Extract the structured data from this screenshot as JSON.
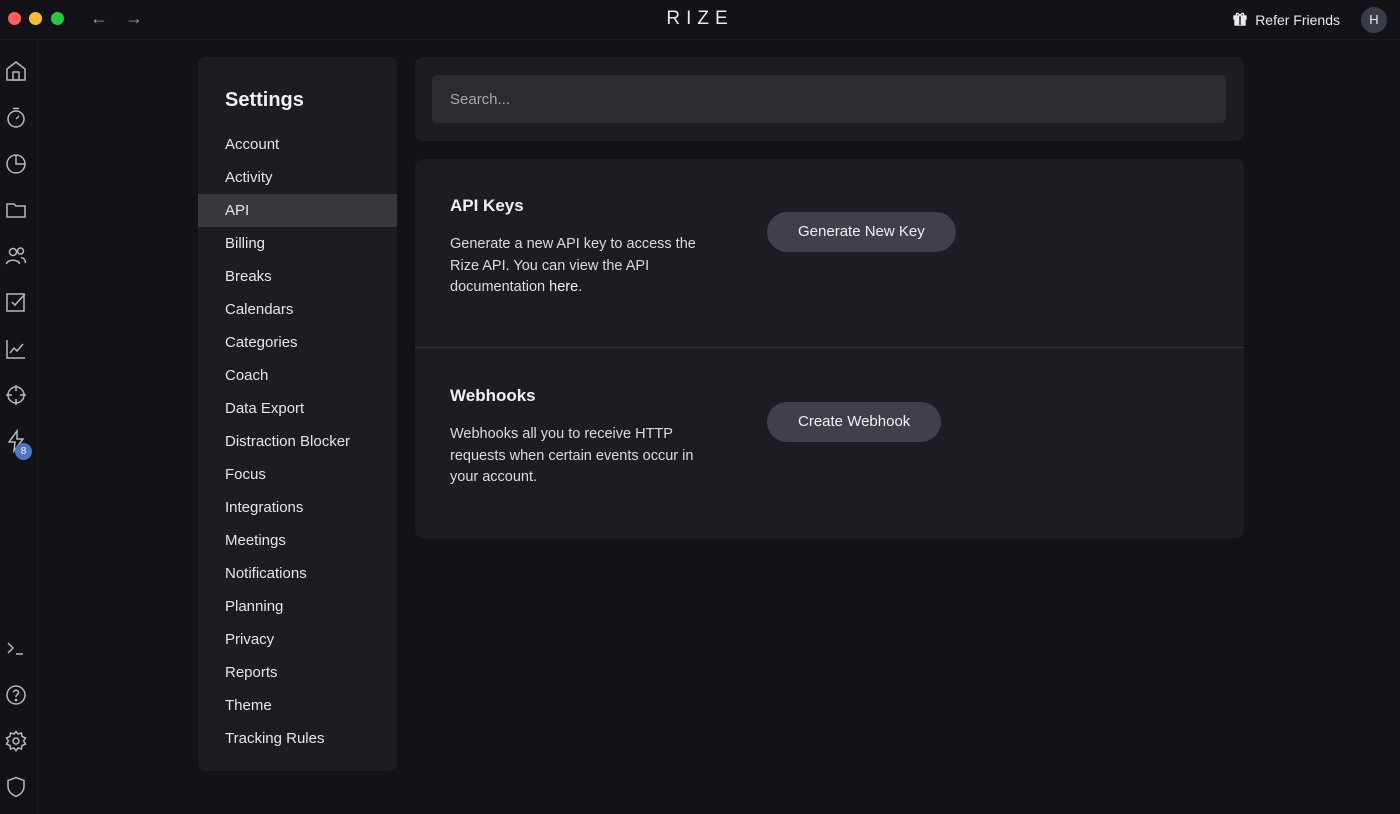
{
  "window": {
    "brand": "RIZE",
    "nav_back_glyph": "←",
    "nav_forward_glyph": "→",
    "refer_label": "Refer Friends",
    "refer_icon": "gift-icon",
    "avatar_initial": "H"
  },
  "rail": {
    "items": [
      {
        "icon": "home-icon"
      },
      {
        "icon": "timer-icon"
      },
      {
        "icon": "pie-chart-icon"
      },
      {
        "icon": "folder-icon"
      },
      {
        "icon": "users-icon"
      },
      {
        "icon": "checkbox-icon"
      },
      {
        "icon": "trend-chart-icon"
      },
      {
        "icon": "target-icon"
      },
      {
        "icon": "lightning-icon",
        "badge": "8"
      }
    ],
    "bottom_items": [
      {
        "icon": "terminal-icon"
      },
      {
        "icon": "help-icon"
      },
      {
        "icon": "gear-icon"
      },
      {
        "icon": "shield-icon"
      }
    ]
  },
  "settings": {
    "title": "Settings",
    "active": "API",
    "items": [
      "Account",
      "Activity",
      "API",
      "Billing",
      "Breaks",
      "Calendars",
      "Categories",
      "Coach",
      "Data Export",
      "Distraction Blocker",
      "Focus",
      "Integrations",
      "Meetings",
      "Notifications",
      "Planning",
      "Privacy",
      "Reports",
      "Theme",
      "Tracking Rules"
    ]
  },
  "search": {
    "placeholder": "Search...",
    "value": ""
  },
  "api_keys": {
    "title": "API Keys",
    "description": "Generate a new API key to access the Rize API. You can view the API documentation ",
    "link_text": "here",
    "description_end": ".",
    "button": "Generate New Key"
  },
  "webhooks": {
    "title": "Webhooks",
    "description": "Webhooks all you to receive HTTP requests when certain events occur in your account.",
    "button": "Create Webhook"
  },
  "colors": {
    "background": "#131217",
    "panel": "#1d1c22",
    "active_item": "#39383f",
    "button": "#403f4a",
    "badge": "#4d74c9"
  }
}
